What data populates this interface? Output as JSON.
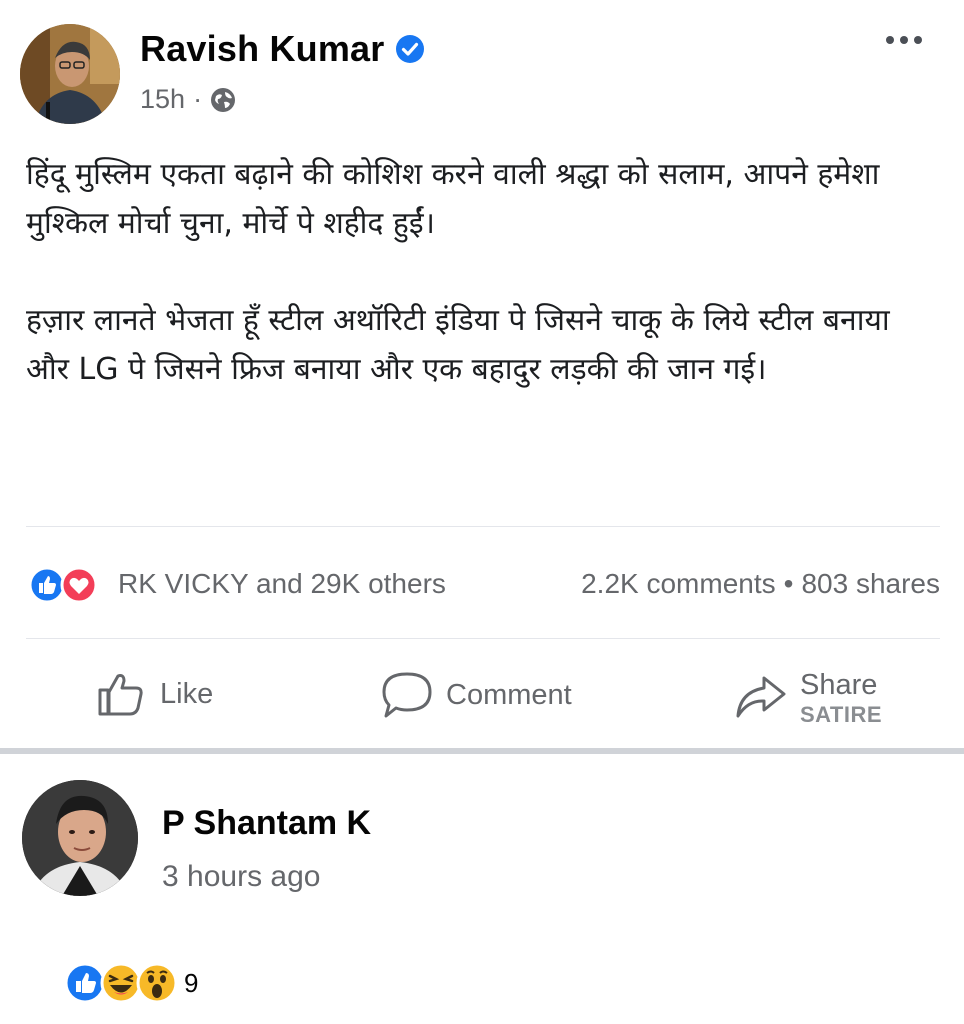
{
  "post": {
    "author": "Ravish Kumar",
    "time": "15h",
    "time_separator": "·",
    "body_paragraphs": [
      "हिंदू मुस्लिम एकता बढ़ाने की कोशिश करने वाली श्रद्धा को सलाम, आपने हमेशा मुश्किल मोर्चा चुना, मोर्चे पे शहीद हुईं।",
      "हज़ार लानते भेजता हूँ स्टील अथॉरिटी इंडिया पे जिसने चाकू के लिये स्टील बनाया और LG पे जिसने फ्रिज बनाया और एक बहादुर लड़की की जान गई।"
    ],
    "reactions_summary": "RK VICKY and 29K others",
    "comments_count": "2.2K comments",
    "stats_separator": "•",
    "shares_count": "803 shares",
    "actions": {
      "like": "Like",
      "comment": "Comment",
      "share": "Share",
      "watermark": "SATIRE"
    },
    "icons": {
      "verified": "verified-badge-icon",
      "privacy": "globe-icon",
      "more": "more-options-icon",
      "reactions": [
        "like-reaction-icon",
        "love-reaction-icon"
      ]
    }
  },
  "comment": {
    "author": "P Shantam K",
    "time": "3 hours ago",
    "reaction_count": "9",
    "reaction_icons": [
      "like-reaction-icon",
      "haha-reaction-icon",
      "wow-reaction-icon"
    ]
  },
  "colors": {
    "facebook_blue": "#1877f2",
    "love_red": "#f33e58",
    "secondary_text": "#65676b",
    "emoji_yellow": "#f7b928"
  }
}
